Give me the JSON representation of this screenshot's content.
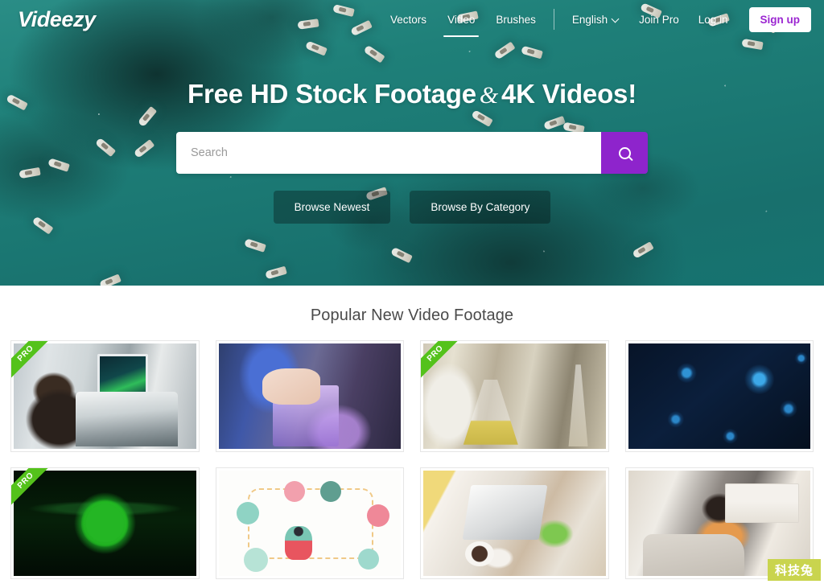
{
  "brand": {
    "logo": "Videezy"
  },
  "nav": {
    "primary": [
      {
        "label": "Vectors",
        "active": false,
        "name": "nav-link-vectors"
      },
      {
        "label": "Video",
        "active": true,
        "name": "nav-link-video"
      },
      {
        "label": "Brushes",
        "active": false,
        "name": "nav-link-brushes"
      }
    ],
    "language": {
      "label": "English",
      "chevron": "chevron-down-icon"
    },
    "join_pro": "Join Pro",
    "log_in": "Log in",
    "sign_up": "Sign up",
    "sign_up_color": "#9b26d1"
  },
  "hero": {
    "headline_part1": "Free HD Stock Footage",
    "headline_amp": "&",
    "headline_part2": "4K Videos!",
    "search": {
      "value": "",
      "placeholder": "Search",
      "button_icon": "search-icon",
      "button_color": "#8e24cc"
    },
    "buttons": [
      {
        "label": "Browse Newest",
        "name": "browse-newest-button"
      },
      {
        "label": "Browse By Category",
        "name": "browse-by-category-button"
      }
    ],
    "background_color": "#1d7a77"
  },
  "main": {
    "section_title": "Popular New Video Footage",
    "pro_badge": "PRO",
    "pro_badge_color": "#54c21b",
    "cards": [
      {
        "name": "video-card-microscope",
        "art": "t-microscope",
        "pro": true
      },
      {
        "name": "video-card-pipette",
        "art": "t-pipette",
        "pro": false
      },
      {
        "name": "video-card-laboratory",
        "art": "t-lab",
        "pro": true
      },
      {
        "name": "video-card-virus",
        "art": "t-virus",
        "pro": false
      },
      {
        "name": "video-card-green-cell",
        "art": "t-cell",
        "pro": true
      },
      {
        "name": "video-card-ecommerce",
        "art": "t-ecom",
        "pro": false
      },
      {
        "name": "video-card-laptop-desk",
        "art": "t-laptop",
        "pro": false
      },
      {
        "name": "video-card-couch-phone",
        "art": "t-couch",
        "pro": false
      }
    ]
  },
  "watermark": {
    "text": "科技兔",
    "color": "#c9d44e"
  }
}
